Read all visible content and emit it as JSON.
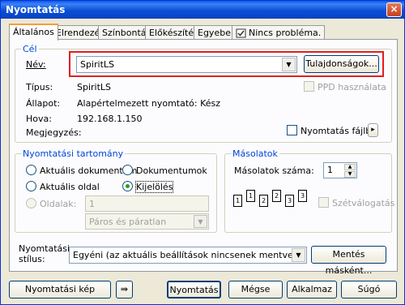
{
  "window": {
    "title": "Nyomtatás",
    "close": "×"
  },
  "tabs": [
    {
      "label": "Általános"
    },
    {
      "label": "Elrendezés"
    },
    {
      "label": "Színbontás"
    },
    {
      "label": "Előkészítés"
    },
    {
      "label": "Egyebek"
    },
    {
      "label": "Nincs probléma."
    }
  ],
  "target": {
    "legend": "Cél",
    "name_label": "Név:",
    "name_value": "SpiritLS",
    "properties_button": "Tulajdonságok...",
    "type_label": "Típus:",
    "type_value": "SpiritLS",
    "ppd_label": "PPD használata",
    "status_label": "Állapot:",
    "status_value": "Alapértelmezett nyomtató: Kész",
    "where_label": "Hova:",
    "where_value": "192.168.1.150",
    "comment_label": "Megjegyzés:",
    "print_to_file_label": "Nyomtatás fájlba",
    "arrow": "▸"
  },
  "range": {
    "legend": "Nyomtatási tartomány",
    "current_doc": "Aktuális dokumentum",
    "documents": "Dokumentumok",
    "current_page": "Aktuális oldal",
    "selection": "Kijelölés",
    "pages_label": "Oldalak:",
    "pages_value": "1",
    "parity_value": "Páros és páratlan"
  },
  "copies": {
    "legend": "Másolatok",
    "count_label": "Másolatok száma:",
    "count_value": "1",
    "collate_label": "Szétválogatás",
    "page_numbers": [
      "1",
      "1",
      "2",
      "2",
      "3",
      "3"
    ]
  },
  "style": {
    "label_line1": "Nyomtatási",
    "label_line2": "stílus:",
    "value": "Egyéni (az aktuális beállítások nincsenek mentve)",
    "save_button": "Mentés másként..."
  },
  "footer": {
    "preview_button": "Nyomtatási kép",
    "arrow_button": "⇛",
    "print_button": "Nyomtatás",
    "cancel_button": "Mégse",
    "apply_button": "Alkalmaz",
    "help_button": "Súgó"
  }
}
